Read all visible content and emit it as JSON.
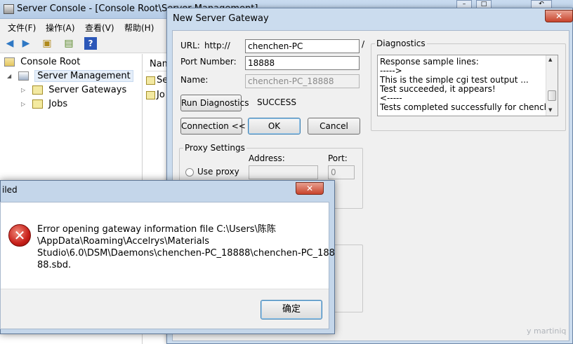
{
  "console": {
    "title": "Server Console - [Console Root\\Server Management]",
    "menu": [
      "文件(F)",
      "操作(A)",
      "查看(V)",
      "帮助(H)"
    ],
    "tree": {
      "root": "Console Root",
      "server_management": "Server Management",
      "server_gateways": "Server Gateways",
      "jobs": "Jobs"
    },
    "list": {
      "header": "Nam",
      "items": [
        "Se",
        "Jo"
      ]
    }
  },
  "gateway_dialog": {
    "title": "New Server Gateway",
    "url_label": "URL:",
    "url_prefix": "http://",
    "url_value": "chenchen-PC",
    "url_suffix": "/",
    "port_label": "Port Number:",
    "port_value": "18888",
    "name_label": "Name:",
    "name_value": "chenchen-PC_18888",
    "run_diagnostics": "Run Diagnostics",
    "status": "SUCCESS",
    "connection_button": "Connection <<",
    "ok_button": "OK",
    "cancel_button": "Cancel",
    "diagnostics": {
      "caption": "Diagnostics",
      "lines": [
        "Response sample lines:",
        "----->",
        "This is the simple cgi test output ...",
        "Test succeeded, it appears!",
        "<-----",
        "Tests completed successfully for chenchen-PC"
      ]
    },
    "proxy": {
      "caption": "Proxy Settings",
      "address_label": "Address:",
      "port_label": "Port:",
      "use_proxy": "Use proxy",
      "port_value": "0"
    }
  },
  "error_box": {
    "title": "iled",
    "message_lines": [
      "Error opening gateway information file C:\\Users\\陈陈",
      "\\AppData\\Roaming\\Accelrys\\Materials",
      "Studio\\6.0\\DSM\\Daemons\\chenchen-PC_18888\\chenchen-PC_188",
      "88.sbd."
    ],
    "ok_button": "确定"
  },
  "watermark": "y martiniq"
}
